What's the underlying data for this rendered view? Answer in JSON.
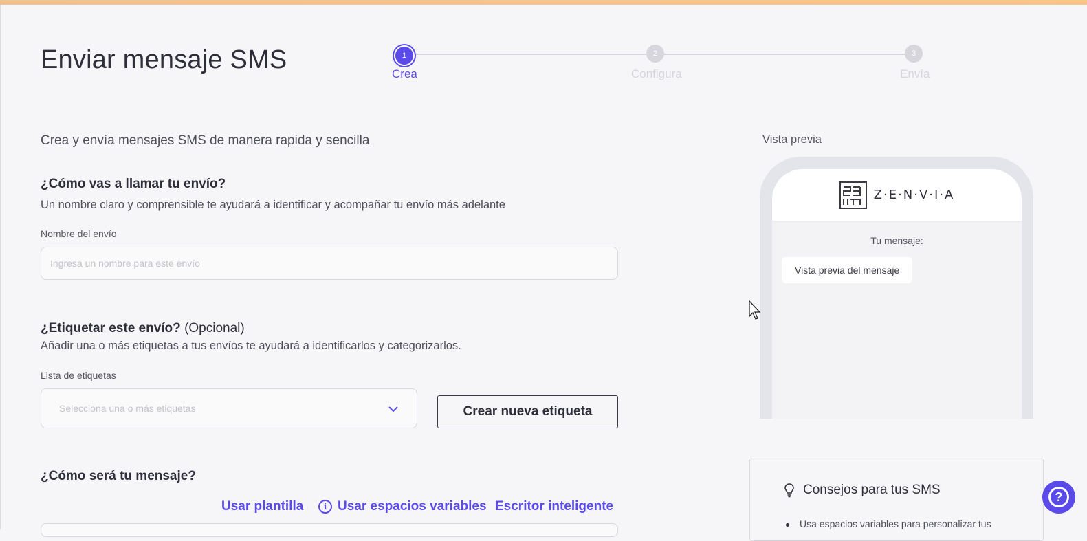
{
  "header": {
    "title": "Enviar mensaje SMS"
  },
  "stepper": {
    "steps": [
      {
        "number": "1",
        "label": "Crea",
        "state": "active"
      },
      {
        "number": "2",
        "label": "Configura",
        "state": "pending"
      },
      {
        "number": "3",
        "label": "Envía",
        "state": "pending"
      }
    ]
  },
  "form": {
    "subtitle": "Crea y envía mensajes SMS de manera rapida y sencilla",
    "name_section": {
      "heading": "¿Cómo vas a llamar tu envío?",
      "description": "Un nombre claro y comprensible te ayudará a identificar y acompañar tu envío más adelante",
      "field_label": "Nombre del envío",
      "placeholder": "Ingresa un nombre para este envío",
      "value": ""
    },
    "tags_section": {
      "heading": "¿Etiquetar este envío?",
      "heading_optional": "(Opcional)",
      "description": "Añadir una o más etiquetas a tus envíos te ayudará a identificarlos y categorizarlos.",
      "field_label": "Lista de etiquetas",
      "select_placeholder": "Selecciona una o más etiquetas",
      "create_button": "Crear nueva etiqueta"
    },
    "message_section": {
      "heading": "¿Cómo será tu mensaje?",
      "links": {
        "template": "Usar plantilla",
        "variables": "Usar espacios variables",
        "smart_writer": "Escritor inteligente"
      }
    }
  },
  "preview": {
    "label": "Vista previa",
    "brand": "Z·E·N·V·I·A",
    "your_message_label": "Tu mensaje:",
    "bubble_text": "Vista previa del mensaje"
  },
  "tips": {
    "title": "Consejos para tus SMS",
    "first_tip_partial": "Usa espacios variables para personalizar tus"
  },
  "icons": {
    "chevron": "chevron-down-icon",
    "info": "info-icon",
    "bulb": "lightbulb-icon",
    "help": "help-icon"
  },
  "colors": {
    "accent": "#5a4bea",
    "top_bar": "#f6c48e",
    "text": "#2f2f3b",
    "muted": "#d5d5dc"
  }
}
